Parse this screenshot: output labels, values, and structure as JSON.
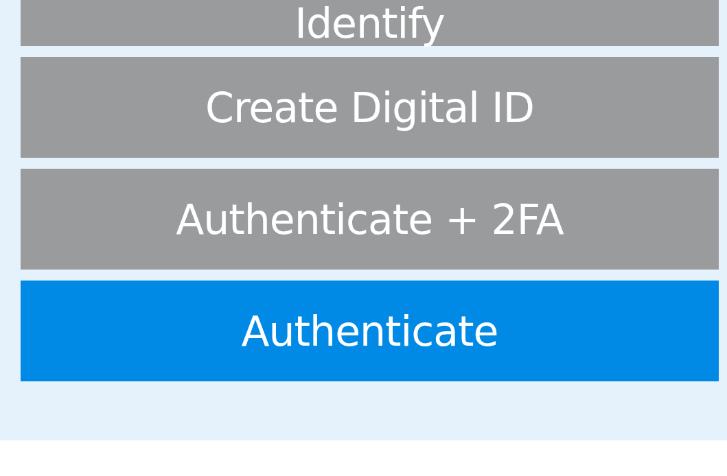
{
  "options": [
    {
      "label": "Identify",
      "selected": false
    },
    {
      "label": "Create Digital ID",
      "selected": false
    },
    {
      "label": "Authenticate + 2FA",
      "selected": false
    },
    {
      "label": "Authenticate",
      "selected": true
    }
  ]
}
